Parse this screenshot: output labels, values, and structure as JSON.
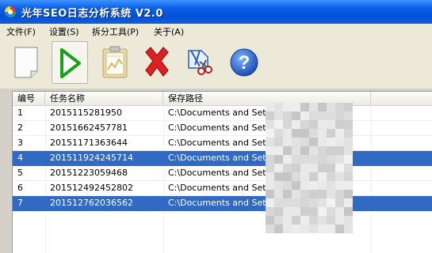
{
  "window": {
    "title": "光年SEO日志分析系统 V2.0"
  },
  "menu": {
    "items": [
      {
        "label": "文件(F)"
      },
      {
        "label": "设置(S)"
      },
      {
        "label": "拆分工具(P)"
      },
      {
        "label": "关于(A)"
      }
    ]
  },
  "toolbar": {
    "buttons": [
      {
        "icon": "new-document-icon"
      },
      {
        "icon": "play-icon"
      },
      {
        "icon": "clipboard-report-icon"
      },
      {
        "icon": "delete-x-icon"
      },
      {
        "icon": "split-scissors-icon"
      },
      {
        "icon": "help-icon"
      }
    ]
  },
  "table": {
    "columns": [
      "编号",
      "任务名称",
      "保存路径"
    ],
    "rows": [
      {
        "id": "1",
        "name": "2015115281950",
        "path": "C:\\Documents and Settings\\",
        "selected": false
      },
      {
        "id": "2",
        "name": "20151662457781",
        "path": "C:\\Documents and Settings",
        "selected": false
      },
      {
        "id": "3",
        "name": "20151171363644",
        "path": "C:\\Documents and Settings",
        "selected": false
      },
      {
        "id": "4",
        "name": "201511924245714",
        "path": "C:\\Documents and Settings",
        "selected": true
      },
      {
        "id": "5",
        "name": "20151223059468",
        "path": "C:\\Documents and Settings",
        "selected": false
      },
      {
        "id": "6",
        "name": "20151249245280​2",
        "path": "C:\\Documents and Settings",
        "selected": false
      },
      {
        "id": "7",
        "name": "201512762036562",
        "path": "C:\\Documents and Setting",
        "selected": true
      }
    ]
  },
  "colors": {
    "titlebar": "#0a5ee8",
    "selection": "#316ac5",
    "face": "#ece9d8"
  }
}
